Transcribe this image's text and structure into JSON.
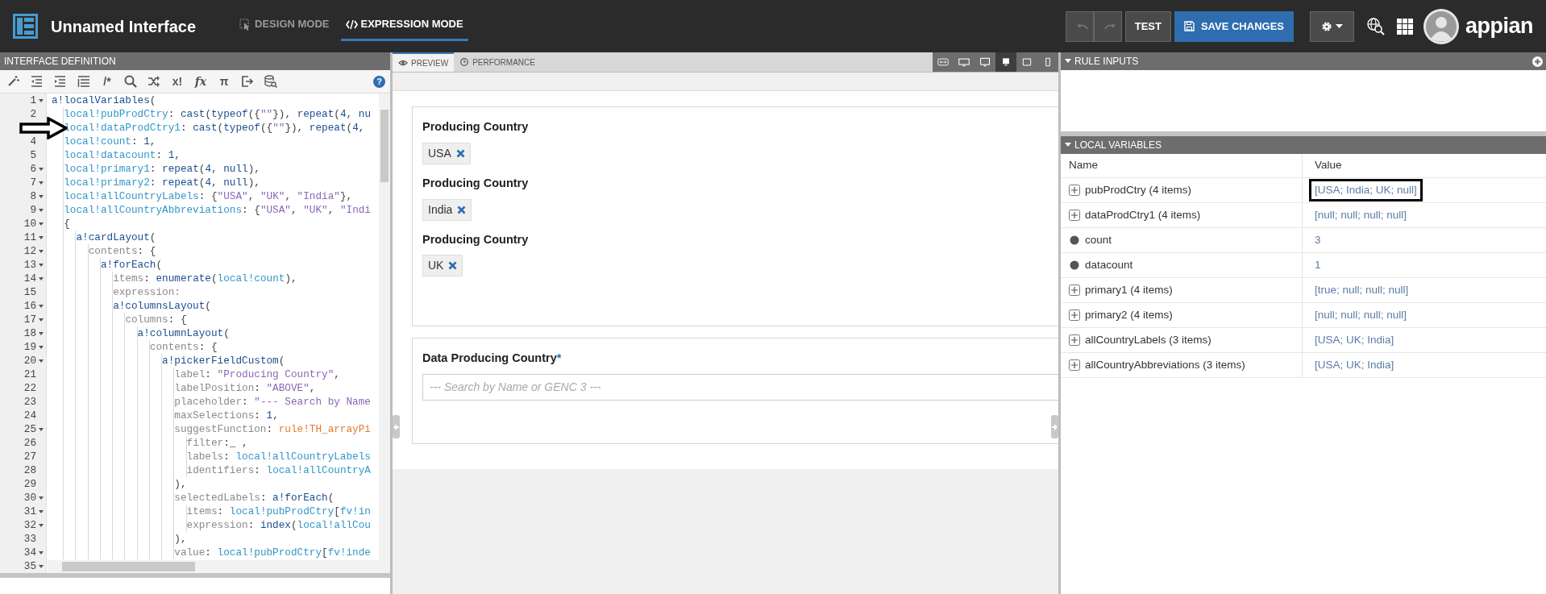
{
  "topbar": {
    "title": "Unnamed Interface",
    "modes": [
      {
        "label": "DESIGN MODE",
        "selected": false
      },
      {
        "label": "EXPRESSION MODE",
        "selected": true
      }
    ],
    "undo": {
      "disabled": true
    },
    "redo": {
      "disabled": true
    },
    "test_button": "TEST",
    "save_button": "SAVE CHANGES",
    "brand": "appian"
  },
  "editor": {
    "title": "INTERFACE DEFINITION",
    "toolbar": [
      {
        "kind": "icon"
      },
      {
        "kind": "icon"
      },
      {
        "kind": "icon"
      },
      {
        "kind": "icon"
      },
      {
        "kind": "glyph",
        "text": "/*"
      },
      {
        "kind": "icon"
      },
      {
        "kind": "icon"
      },
      {
        "kind": "glyph",
        "text": "x!"
      },
      {
        "kind": "glyph",
        "text": "fx"
      },
      {
        "kind": "glyph",
        "text": "π"
      },
      {
        "kind": "icon"
      },
      {
        "kind": "icon"
      }
    ],
    "help": "?",
    "lines": [
      {
        "number": "1",
        "foldable": true,
        "marked": false,
        "tokens": [
          {
            "kind": "f",
            "text": "a!localVariables"
          },
          {
            "kind": "o",
            "text": "("
          }
        ]
      },
      {
        "number": "2",
        "foldable": false,
        "marked": false,
        "tokens": [
          {
            "kind": "v",
            "text": "  local!pubProdCtry"
          },
          {
            "kind": "o",
            "text": ": "
          },
          {
            "kind": "f",
            "text": "cast"
          },
          {
            "kind": "o",
            "text": "("
          },
          {
            "kind": "f",
            "text": "typeof"
          },
          {
            "kind": "o",
            "text": "({"
          },
          {
            "kind": "s",
            "text": "\"\""
          },
          {
            "kind": "o",
            "text": "}), "
          },
          {
            "kind": "f",
            "text": "repeat"
          },
          {
            "kind": "o",
            "text": "("
          },
          {
            "kind": "n",
            "text": "4"
          },
          {
            "kind": "o",
            "text": ", "
          },
          {
            "kind": "f",
            "text": "nu"
          }
        ]
      },
      {
        "foldable": false,
        "marked": true,
        "tokens": [
          {
            "kind": "v",
            "text": "  local!dataProdCtry1"
          },
          {
            "kind": "o",
            "text": ": "
          },
          {
            "kind": "f",
            "text": "cast"
          },
          {
            "kind": "o",
            "text": "("
          },
          {
            "kind": "f",
            "text": "typeof"
          },
          {
            "kind": "o",
            "text": "({"
          },
          {
            "kind": "s",
            "text": "\"\""
          },
          {
            "kind": "o",
            "text": "}), "
          },
          {
            "kind": "f",
            "text": "repeat"
          },
          {
            "kind": "o",
            "text": "("
          },
          {
            "kind": "n",
            "text": "4"
          },
          {
            "kind": "o",
            "text": ","
          }
        ]
      },
      {
        "number": "4",
        "foldable": false,
        "marked": false,
        "tokens": [
          {
            "kind": "v",
            "text": "  local!count"
          },
          {
            "kind": "o",
            "text": ": "
          },
          {
            "kind": "n",
            "text": "1"
          },
          {
            "kind": "o",
            "text": ","
          }
        ]
      },
      {
        "number": "5",
        "foldable": false,
        "marked": false,
        "tokens": [
          {
            "kind": "v",
            "text": "  local!datacount"
          },
          {
            "kind": "o",
            "text": ": "
          },
          {
            "kind": "n",
            "text": "1"
          },
          {
            "kind": "o",
            "text": ","
          }
        ]
      },
      {
        "number": "6",
        "foldable": true,
        "marked": false,
        "tokens": [
          {
            "kind": "v",
            "text": "  local!primary1"
          },
          {
            "kind": "o",
            "text": ": "
          },
          {
            "kind": "f",
            "text": "repeat"
          },
          {
            "kind": "o",
            "text": "("
          },
          {
            "kind": "n",
            "text": "4"
          },
          {
            "kind": "o",
            "text": ", "
          },
          {
            "kind": "f",
            "text": "null"
          },
          {
            "kind": "o",
            "text": "),"
          }
        ]
      },
      {
        "number": "7",
        "foldable": true,
        "marked": false,
        "tokens": [
          {
            "kind": "v",
            "text": "  local!primary2"
          },
          {
            "kind": "o",
            "text": ": "
          },
          {
            "kind": "f",
            "text": "repeat"
          },
          {
            "kind": "o",
            "text": "("
          },
          {
            "kind": "n",
            "text": "4"
          },
          {
            "kind": "o",
            "text": ", "
          },
          {
            "kind": "f",
            "text": "null"
          },
          {
            "kind": "o",
            "text": "),"
          }
        ]
      },
      {
        "number": "8",
        "foldable": true,
        "marked": false,
        "tokens": [
          {
            "kind": "v",
            "text": "  local!allCountryLabels"
          },
          {
            "kind": "o",
            "text": ": {"
          },
          {
            "kind": "s",
            "text": "\"USA\""
          },
          {
            "kind": "o",
            "text": ", "
          },
          {
            "kind": "s",
            "text": "\"UK\""
          },
          {
            "kind": "o",
            "text": ", "
          },
          {
            "kind": "s",
            "text": "\"India\""
          },
          {
            "kind": "o",
            "text": "},"
          }
        ]
      },
      {
        "number": "9",
        "foldable": true,
        "marked": false,
        "tokens": [
          {
            "kind": "v",
            "text": "  local!allCountryAbbreviations"
          },
          {
            "kind": "o",
            "text": ": {"
          },
          {
            "kind": "s",
            "text": "\"USA\""
          },
          {
            "kind": "o",
            "text": ", "
          },
          {
            "kind": "s",
            "text": "\"UK\""
          },
          {
            "kind": "o",
            "text": ", "
          },
          {
            "kind": "s",
            "text": "\"Indi"
          }
        ]
      },
      {
        "number": "10",
        "foldable": true,
        "marked": false,
        "tokens": [
          {
            "kind": "o",
            "text": "  {"
          }
        ]
      },
      {
        "number": "11",
        "foldable": true,
        "marked": false,
        "tokens": [
          {
            "kind": "f",
            "text": "    a!cardLayout"
          },
          {
            "kind": "o",
            "text": "("
          }
        ]
      },
      {
        "number": "12",
        "foldable": true,
        "marked": false,
        "tokens": [
          {
            "kind": "p",
            "text": "      contents"
          },
          {
            "kind": "o",
            "text": ": {"
          }
        ]
      },
      {
        "number": "13",
        "foldable": true,
        "marked": false,
        "tokens": [
          {
            "kind": "f",
            "text": "        a!forEach"
          },
          {
            "kind": "o",
            "text": "("
          }
        ]
      },
      {
        "number": "14",
        "foldable": true,
        "marked": false,
        "tokens": [
          {
            "kind": "p",
            "text": "          items"
          },
          {
            "kind": "o",
            "text": ": "
          },
          {
            "kind": "f",
            "text": "enumerate"
          },
          {
            "kind": "o",
            "text": "("
          },
          {
            "kind": "v",
            "text": "local!count"
          },
          {
            "kind": "o",
            "text": "),"
          }
        ]
      },
      {
        "number": "15",
        "foldable": false,
        "marked": false,
        "tokens": [
          {
            "kind": "p",
            "text": "          expression:"
          }
        ]
      },
      {
        "number": "16",
        "foldable": true,
        "marked": false,
        "tokens": [
          {
            "kind": "f",
            "text": "          a!columnsLayout"
          },
          {
            "kind": "o",
            "text": "("
          }
        ]
      },
      {
        "number": "17",
        "foldable": true,
        "marked": false,
        "tokens": [
          {
            "kind": "p",
            "text": "            columns"
          },
          {
            "kind": "o",
            "text": ": {"
          }
        ]
      },
      {
        "number": "18",
        "foldable": true,
        "marked": false,
        "tokens": [
          {
            "kind": "f",
            "text": "              a!columnLayout"
          },
          {
            "kind": "o",
            "text": "("
          }
        ]
      },
      {
        "number": "19",
        "foldable": true,
        "marked": false,
        "tokens": [
          {
            "kind": "p",
            "text": "                contents"
          },
          {
            "kind": "o",
            "text": ": {"
          }
        ]
      },
      {
        "number": "20",
        "foldable": true,
        "marked": false,
        "tokens": [
          {
            "kind": "f",
            "text": "                  a!pickerFieldCustom"
          },
          {
            "kind": "o",
            "text": "("
          }
        ]
      },
      {
        "number": "21",
        "foldable": false,
        "marked": false,
        "tokens": [
          {
            "kind": "p",
            "text": "                    label"
          },
          {
            "kind": "o",
            "text": ": "
          },
          {
            "kind": "s",
            "text": "\"Producing Country\""
          },
          {
            "kind": "o",
            "text": ","
          }
        ]
      },
      {
        "number": "22",
        "foldable": false,
        "marked": false,
        "tokens": [
          {
            "kind": "p",
            "text": "                    labelPosition"
          },
          {
            "kind": "o",
            "text": ": "
          },
          {
            "kind": "s",
            "text": "\"ABOVE\""
          },
          {
            "kind": "o",
            "text": ","
          }
        ]
      },
      {
        "number": "23",
        "foldable": false,
        "marked": false,
        "tokens": [
          {
            "kind": "p",
            "text": "                    placeholder"
          },
          {
            "kind": "o",
            "text": ": "
          },
          {
            "kind": "s",
            "text": "\"--- Search by Name"
          }
        ]
      },
      {
        "number": "24",
        "foldable": false,
        "marked": false,
        "tokens": [
          {
            "kind": "p",
            "text": "                    maxSelections"
          },
          {
            "kind": "o",
            "text": ": "
          },
          {
            "kind": "n",
            "text": "1"
          },
          {
            "kind": "o",
            "text": ","
          }
        ]
      },
      {
        "number": "25",
        "foldable": true,
        "marked": false,
        "tokens": [
          {
            "kind": "p",
            "text": "                    suggestFunction"
          },
          {
            "kind": "o",
            "text": ": "
          },
          {
            "kind": "r",
            "text": "rule!TH_arrayPi"
          }
        ]
      },
      {
        "number": "26",
        "foldable": false,
        "marked": false,
        "tokens": [
          {
            "kind": "p",
            "text": "                      filter"
          },
          {
            "kind": "o",
            "text": ":_ ,"
          }
        ]
      },
      {
        "number": "27",
        "foldable": false,
        "marked": false,
        "tokens": [
          {
            "kind": "p",
            "text": "                      labels"
          },
          {
            "kind": "o",
            "text": ": "
          },
          {
            "kind": "v",
            "text": "local!allCountryLabels"
          }
        ]
      },
      {
        "number": "28",
        "foldable": false,
        "marked": false,
        "tokens": [
          {
            "kind": "p",
            "text": "                      identifiers"
          },
          {
            "kind": "o",
            "text": ": "
          },
          {
            "kind": "v",
            "text": "local!allCountryA"
          }
        ]
      },
      {
        "number": "29",
        "foldable": false,
        "marked": false,
        "tokens": [
          {
            "kind": "o",
            "text": "                    ),"
          }
        ]
      },
      {
        "number": "30",
        "foldable": true,
        "marked": false,
        "tokens": [
          {
            "kind": "p",
            "text": "                    selectedLabels"
          },
          {
            "kind": "o",
            "text": ": "
          },
          {
            "kind": "f",
            "text": "a!forEach"
          },
          {
            "kind": "o",
            "text": "("
          }
        ]
      },
      {
        "number": "31",
        "foldable": true,
        "marked": false,
        "tokens": [
          {
            "kind": "p",
            "text": "                      items"
          },
          {
            "kind": "o",
            "text": ": "
          },
          {
            "kind": "v",
            "text": "local!pubProdCtry"
          },
          {
            "kind": "o",
            "text": "["
          },
          {
            "kind": "v",
            "text": "fv!in"
          }
        ]
      },
      {
        "number": "32",
        "foldable": true,
        "marked": false,
        "tokens": [
          {
            "kind": "p",
            "text": "                      expression"
          },
          {
            "kind": "o",
            "text": ": "
          },
          {
            "kind": "f",
            "text": "index"
          },
          {
            "kind": "o",
            "text": "("
          },
          {
            "kind": "v",
            "text": "local!allCou"
          }
        ]
      },
      {
        "number": "33",
        "foldable": false,
        "marked": false,
        "tokens": [
          {
            "kind": "o",
            "text": "                    ),"
          }
        ]
      },
      {
        "number": "34",
        "foldable": true,
        "marked": false,
        "tokens": [
          {
            "kind": "p",
            "text": "                    value"
          },
          {
            "kind": "o",
            "text": ": "
          },
          {
            "kind": "v",
            "text": "local!pubProdCtry"
          },
          {
            "kind": "o",
            "text": "["
          },
          {
            "kind": "v",
            "text": "fv!inde"
          }
        ]
      },
      {
        "number": "35",
        "foldable": true,
        "marked": false
      }
    ]
  },
  "preview": {
    "tabs": [
      {
        "label": "PREVIEW",
        "selected": true
      },
      {
        "label": "PERFORMANCE",
        "selected": false
      }
    ],
    "devices": [
      {
        "selected": false
      },
      {
        "selected": false
      },
      {
        "selected": false
      },
      {
        "selected": true
      },
      {
        "selected": false
      },
      {
        "selected": false
      }
    ],
    "cards": [
      {
        "fields": [
          {
            "label": "Producing Country",
            "chips": [
              "USA"
            ]
          },
          {
            "label": "Producing Country",
            "chips": [
              "India"
            ]
          },
          {
            "label": "Producing Country",
            "chips": [
              "UK"
            ]
          }
        ]
      },
      {
        "fields": [
          {
            "label": "Data Producing Country",
            "required_mark": "*",
            "placeholder": "--- Search by Name or GENC 3 ---"
          }
        ]
      }
    ]
  },
  "rule_inputs": {
    "title": "RULE INPUTS",
    "expanded": true
  },
  "local_variables": {
    "title": "LOCAL VARIABLES",
    "expanded": true,
    "columns": [
      "Name",
      "Value"
    ],
    "rows": [
      {
        "kind": "list",
        "name": "pubProdCtry (4 items)",
        "value": "[USA; India; UK; null]",
        "boxed": true
      },
      {
        "kind": "list",
        "name": "dataProdCtry1 (4 items)",
        "value": "[null; null; null; null]",
        "boxed": false
      },
      {
        "kind": "scalar",
        "name": "count",
        "value": "3",
        "boxed": false
      },
      {
        "kind": "scalar",
        "name": "datacount",
        "value": "1",
        "boxed": false
      },
      {
        "kind": "list",
        "name": "primary1 (4 items)",
        "value": "[true; null; null; null]",
        "boxed": false
      },
      {
        "kind": "list",
        "name": "primary2 (4 items)",
        "value": "[null; null; null; null]",
        "boxed": false
      },
      {
        "kind": "list",
        "name": "allCountryLabels (3 items)",
        "value": "[USA; UK; India]",
        "boxed": false
      },
      {
        "kind": "list",
        "name": "allCountryAbbreviations (3 items)",
        "value": "[USA; UK; India]",
        "boxed": false
      }
    ]
  }
}
